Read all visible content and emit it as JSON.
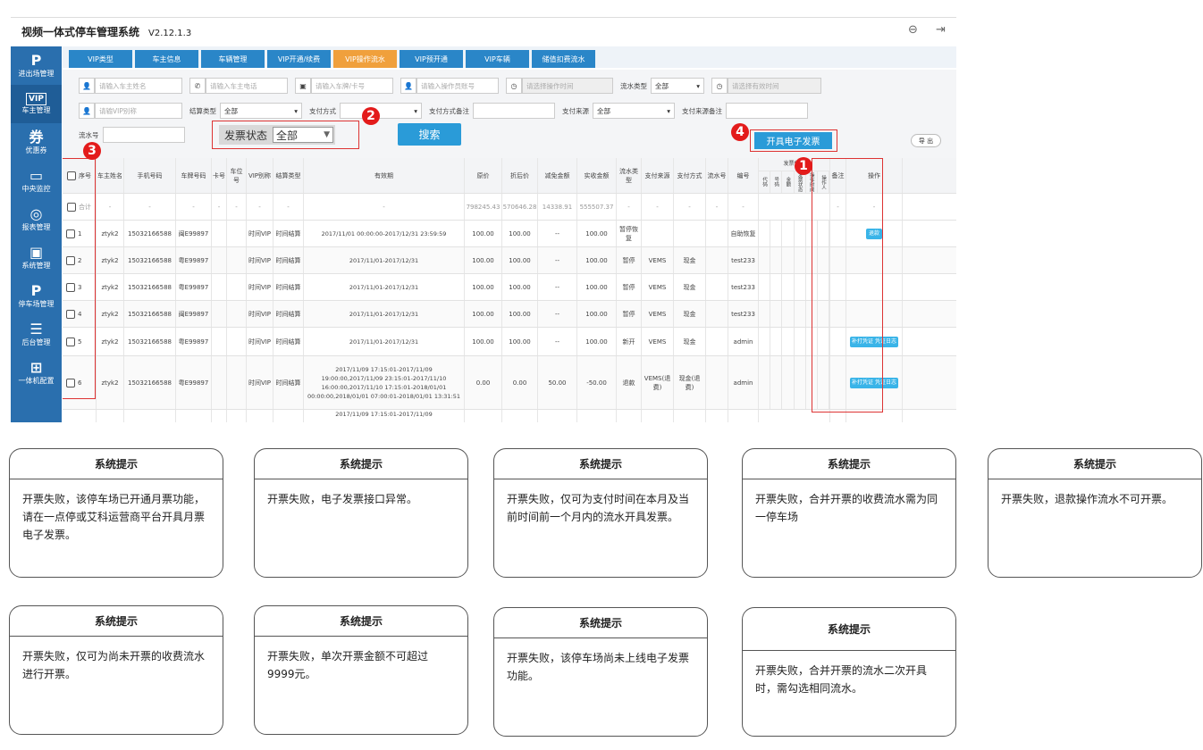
{
  "app": {
    "title": "视频一体式停车管理系统",
    "version": "V2.12.1.3"
  },
  "sidebar": {
    "items": [
      {
        "icon": "P",
        "label": "进出场管理"
      },
      {
        "icon": "VIP",
        "label": "车主管理"
      },
      {
        "icon": "券",
        "label": "优惠券"
      },
      {
        "icon": "▭",
        "label": "中央监控"
      },
      {
        "icon": "◎",
        "label": "报表管理"
      },
      {
        "icon": "▣",
        "label": "系统管理"
      },
      {
        "icon": "P",
        "label": "停车场管理"
      },
      {
        "icon": "☰",
        "label": "后台管理"
      },
      {
        "icon": "⊞",
        "label": "一体机配置"
      }
    ]
  },
  "tabs": [
    "VIP类型",
    "车主信息",
    "车辆管理",
    "VIP开通/续费",
    "VIP操作流水",
    "VIP预开通",
    "VIP车辆",
    "储值扣费流水"
  ],
  "active_tab": "VIP操作流水",
  "filters": {
    "owner_name_placeholder": "请输入车主姓名",
    "owner_phone_placeholder": "请输入车主电话",
    "plate_placeholder": "请输入车牌/卡号",
    "operator_placeholder": "请输入操作员账号",
    "op_time_placeholder": "请选择操作时间",
    "flow_type_label": "流水类型",
    "flow_type_value": "全部",
    "valid_time_placeholder": "请选择有效时间",
    "vip_name_placeholder": "请输VIP别称",
    "settle_type_label": "结算类型",
    "settle_type_value": "全部",
    "pay_method_label": "支付方式",
    "pay_method_note_label": "支付方式备注",
    "pay_source_label": "支付来源",
    "pay_source_value": "全部",
    "pay_source_note_label": "支付来源备注",
    "serial_label": "流水号",
    "invoice_status_label": "发票状态",
    "invoice_status_value": "全部",
    "search_label": "搜索",
    "issue_invoice_label": "开具电子发票",
    "export_label": "导 出"
  },
  "badges": [
    "1",
    "2",
    "3",
    "4"
  ],
  "table": {
    "headers": [
      "序号",
      "车主姓名",
      "手机号码",
      "车牌号码",
      "卡号",
      "车位号",
      "VIP别称",
      "结算类型",
      "有效期",
      "原价",
      "折后价",
      "减免金额",
      "实收金额",
      "流水类型",
      "支付来源",
      "支付方式",
      "流水号",
      "编号",
      "发票信息",
      "备注",
      "操作"
    ],
    "invoice_sub": [
      "代码",
      "号码",
      "金额",
      "发票状态",
      "操作时间",
      "操作人"
    ],
    "total": {
      "label": "合计",
      "dash": "-",
      "orig": "798245.43",
      "disc": "570646.28",
      "reduce": "14338.91",
      "paid": "555507.37"
    },
    "rows": [
      {
        "no": "1",
        "name": "ztyk2",
        "phone": "15032166588",
        "plate": "闽E99897",
        "alias": "时间VIP",
        "settle": "时间结算",
        "valid": "2017/11/01 00:00:00-2017/12/31 23:59:59",
        "orig": "100.00",
        "disc": "100.00",
        "reduce": "--",
        "paid": "100.00",
        "type": "暂停恢复",
        "src": "",
        "method": "",
        "code": "自助恢复",
        "op": "退款"
      },
      {
        "no": "2",
        "name": "ztyk2",
        "phone": "15032166588",
        "plate": "粤E99897",
        "alias": "时间VIP",
        "settle": "时间结算",
        "valid": "2017/11/01-2017/12/31",
        "orig": "100.00",
        "disc": "100.00",
        "reduce": "--",
        "paid": "100.00",
        "type": "暂停",
        "src": "VEMS",
        "method": "现金",
        "code": "test233",
        "op": ""
      },
      {
        "no": "3",
        "name": "ztyk2",
        "phone": "15032166588",
        "plate": "粤E99897",
        "alias": "时间VIP",
        "settle": "时间结算",
        "valid": "2017/11/01-2017/12/31",
        "orig": "100.00",
        "disc": "100.00",
        "reduce": "--",
        "paid": "100.00",
        "type": "暂停",
        "src": "VEMS",
        "method": "现金",
        "code": "test233",
        "op": ""
      },
      {
        "no": "4",
        "name": "ztyk2",
        "phone": "15032166588",
        "plate": "闽E99897",
        "alias": "时间VIP",
        "settle": "时间结算",
        "valid": "2017/11/01-2017/12/31",
        "orig": "100.00",
        "disc": "100.00",
        "reduce": "--",
        "paid": "100.00",
        "type": "暂停",
        "src": "VEMS",
        "method": "现金",
        "code": "test233",
        "op": ""
      },
      {
        "no": "5",
        "name": "ztyk2",
        "phone": "15032166588",
        "plate": "粤E99897",
        "alias": "时间VIP",
        "settle": "时间结算",
        "valid": "2017/11/01-2017/12/31",
        "orig": "100.00",
        "disc": "100.00",
        "reduce": "--",
        "paid": "100.00",
        "type": "新开",
        "src": "VEMS",
        "method": "现金",
        "code": "admin",
        "op": "补打凭证 凭证日志"
      },
      {
        "no": "6",
        "name": "ztyk2",
        "phone": "15032166588",
        "plate": "粤E99897",
        "alias": "时间VIP",
        "settle": "时间结算",
        "valid": "2017/11/09 17:15:01-2017/11/09 19:00:00,2017/11/09 23:15:01-2017/11/10 16:00:00,2017/11/10 17:15:01-2018/01/01 00:00:00,2018/01/01 07:00:01-2018/01/01 13:31:51",
        "orig": "0.00",
        "disc": "0.00",
        "reduce": "50.00",
        "paid": "-50.00",
        "type": "退款",
        "src": "VEMS(退费)",
        "method": "现金(退费)",
        "code": "admin",
        "op": "补打凭证 凭证日志"
      }
    ],
    "partial_row_text": "2017/11/09 17:15:01-2017/11/09"
  },
  "dialogs": [
    {
      "title": "系统提示",
      "message": "开票失败，该停车场已开通月票功能，请在一点停或艾科运营商平台开具月票电子发票。"
    },
    {
      "title": "系统提示",
      "message": "开票失败，电子发票接口异常。"
    },
    {
      "title": "系统提示",
      "message": "开票失败，仅可为支付时间在本月及当前时间前一个月内的流水开具发票。"
    },
    {
      "title": "系统提示",
      "message": "开票失败，合并开票的收费流水需为同一停车场"
    },
    {
      "title": "系统提示",
      "message": "开票失败，退款操作流水不可开票。"
    },
    {
      "title": "系统提示",
      "message": "开票失败，仅可为尚未开票的收费流水进行开票。"
    },
    {
      "title": "系统提示",
      "message": "开票失败，单次开票金额不可超过9999元。"
    },
    {
      "title": "系统提示",
      "message": "开票失败，该停车场尚未上线电子发票功能。"
    },
    {
      "title": "系统提示",
      "message": "开票失败，合并开票的流水二次开具时，需勾选相同流水。"
    }
  ]
}
